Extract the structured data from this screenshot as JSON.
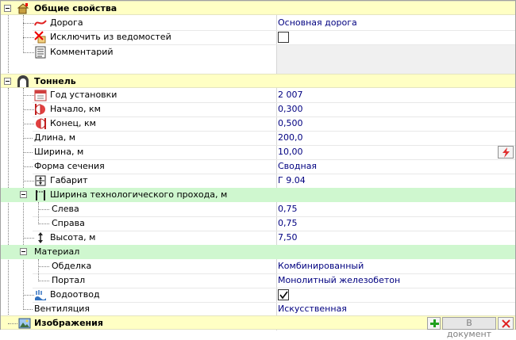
{
  "sections": {
    "general": "Общие свойства",
    "tunnel": "Тоннель",
    "images": "Изображения"
  },
  "general": {
    "road_label": "Дорога",
    "road_value": "Основная дорога",
    "exclude_label": "Исключить из ведомостей",
    "comment_label": "Комментарий"
  },
  "tunnel": {
    "year_label": "Год установки",
    "year_value": "2 007",
    "start_label": "Начало, км",
    "start_value": "0,300",
    "end_label": "Конец, км",
    "end_value": "0,500",
    "length_label": "Длина, м",
    "length_value": "200,0",
    "width_label": "Ширина, м",
    "width_value": "10,00",
    "shape_label": "Форма сечения",
    "shape_value": "Сводная",
    "gabarit_label": "Габарит",
    "gabarit_value": "Г 9.04",
    "passage_label": "Ширина технологического прохода, м",
    "left_label": "Слева",
    "left_value": "0,75",
    "right_label": "Справа",
    "right_value": "0,75",
    "height_label": "Высота, м",
    "height_value": "7,50",
    "material_label": "Материал",
    "finish_label": "Обделка",
    "finish_value": "Комбинированный",
    "portal_label": "Портал",
    "portal_value": "Монолитный железобетон",
    "drainage_label": "Водоотвод",
    "vent_label": "Вентиляция",
    "vent_value": "Искусственная"
  },
  "images": {
    "to_document": "В документ"
  }
}
